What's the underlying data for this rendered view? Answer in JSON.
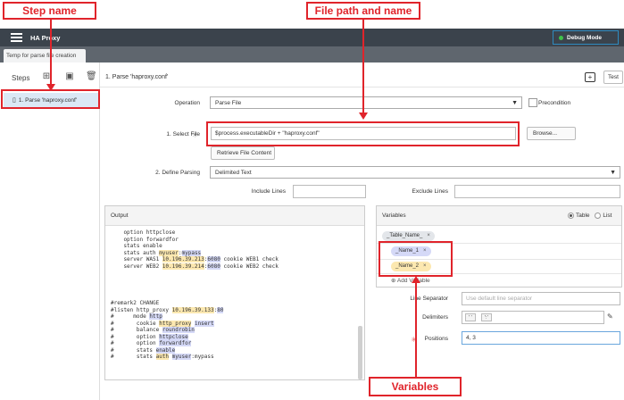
{
  "app": {
    "title": "HA Proxy",
    "debug_label": "Debug Mode"
  },
  "tab": {
    "label": "Temp for parse file creation"
  },
  "steps_panel": {
    "title": "Steps",
    "items": [
      {
        "label": "1. Parse 'haproxy.conf'"
      }
    ]
  },
  "header": {
    "title": "1. Parse 'haproxy.conf'",
    "test_label": "Test"
  },
  "form": {
    "operation_label": "Operation",
    "operation_value": "Parse File",
    "precondition_label": "Precondition",
    "select_file_label": "1. Select File",
    "select_file_value": "$process.executableDir + \"haproxy.conf\"",
    "browse_label": "Browse...",
    "retrieve_label": "Retrieve File Content",
    "define_parsing_label": "2. Define Parsing",
    "define_parsing_value": "Delimited Text",
    "include_lines_label": "Include Lines",
    "exclude_lines_label": "Exclude Lines"
  },
  "output": {
    "title": "Output",
    "block1": [
      "    option httpclose",
      "    option forwardfor",
      "    stats enable"
    ],
    "block2": [
      "#remark2 CHANGE"
    ]
  },
  "variables": {
    "title": "Variables",
    "mode_table": "Table",
    "mode_list": "List",
    "chips": [
      "_Table_Name_",
      "_Name_1",
      "_Name_2"
    ],
    "add_label": "Add Variable",
    "line_separator_label": "Line Separator",
    "line_separator_placeholder": "Use default line separator",
    "delimiters_label": "Delimiters",
    "delimiters": [
      "' '",
      "':'"
    ],
    "positions_label": "Positions",
    "positions_value": "4, 3"
  },
  "annotations": {
    "step_name": "Step name",
    "file_path": "File path and name",
    "variables": "Variables"
  },
  "colors": {
    "annotation": "#e0242b",
    "topbar": "#3b434c",
    "selected_step": "#dbe8f5"
  }
}
